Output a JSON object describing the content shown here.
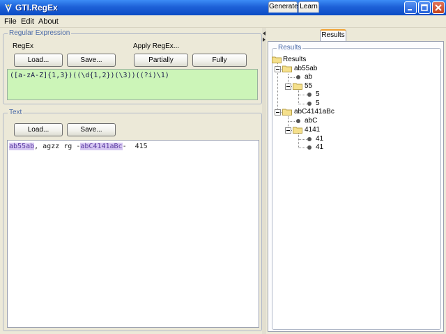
{
  "window": {
    "title": "GTI.RegEx",
    "app_icon": "regex-app-icon"
  },
  "menu": {
    "items": [
      "File",
      "Edit",
      "About"
    ]
  },
  "regex_group": {
    "title": "Regular Expression",
    "regex_label": "RegEx",
    "apply_label": "Apply RegEx...",
    "load_label": "Load...",
    "save_label": "Save...",
    "partially_label": "Partially",
    "fully_label": "Fully",
    "expression": "([a-zA-Z]{1,3})((\\d{1,2})(\\3))((?i)\\1)"
  },
  "text_group": {
    "title": "Text",
    "load_label": "Load...",
    "save_label": "Save...",
    "segments": [
      "ab55ab",
      ", agzz rg -",
      "abC4141aBc",
      "-  415"
    ]
  },
  "tabs": {
    "items": [
      "Generate",
      "Learn",
      "Results"
    ],
    "active": "Results"
  },
  "results": {
    "title": "Results",
    "root": "Results",
    "match1": "ab55ab",
    "m1_child1": "ab",
    "m1_folder": "55",
    "m1_leaf1": "5",
    "m1_leaf2": "5",
    "match2": "abC4141aBc",
    "m2_child1": "abC",
    "m2_folder": "4141",
    "m2_leaf1": "41",
    "m2_leaf2": "41"
  },
  "colors": {
    "regex_bg": "#ccf5b8",
    "highlight": "#d6c7f2",
    "titlebar": "#1e61d8",
    "tab_accent": "#f0a030"
  }
}
